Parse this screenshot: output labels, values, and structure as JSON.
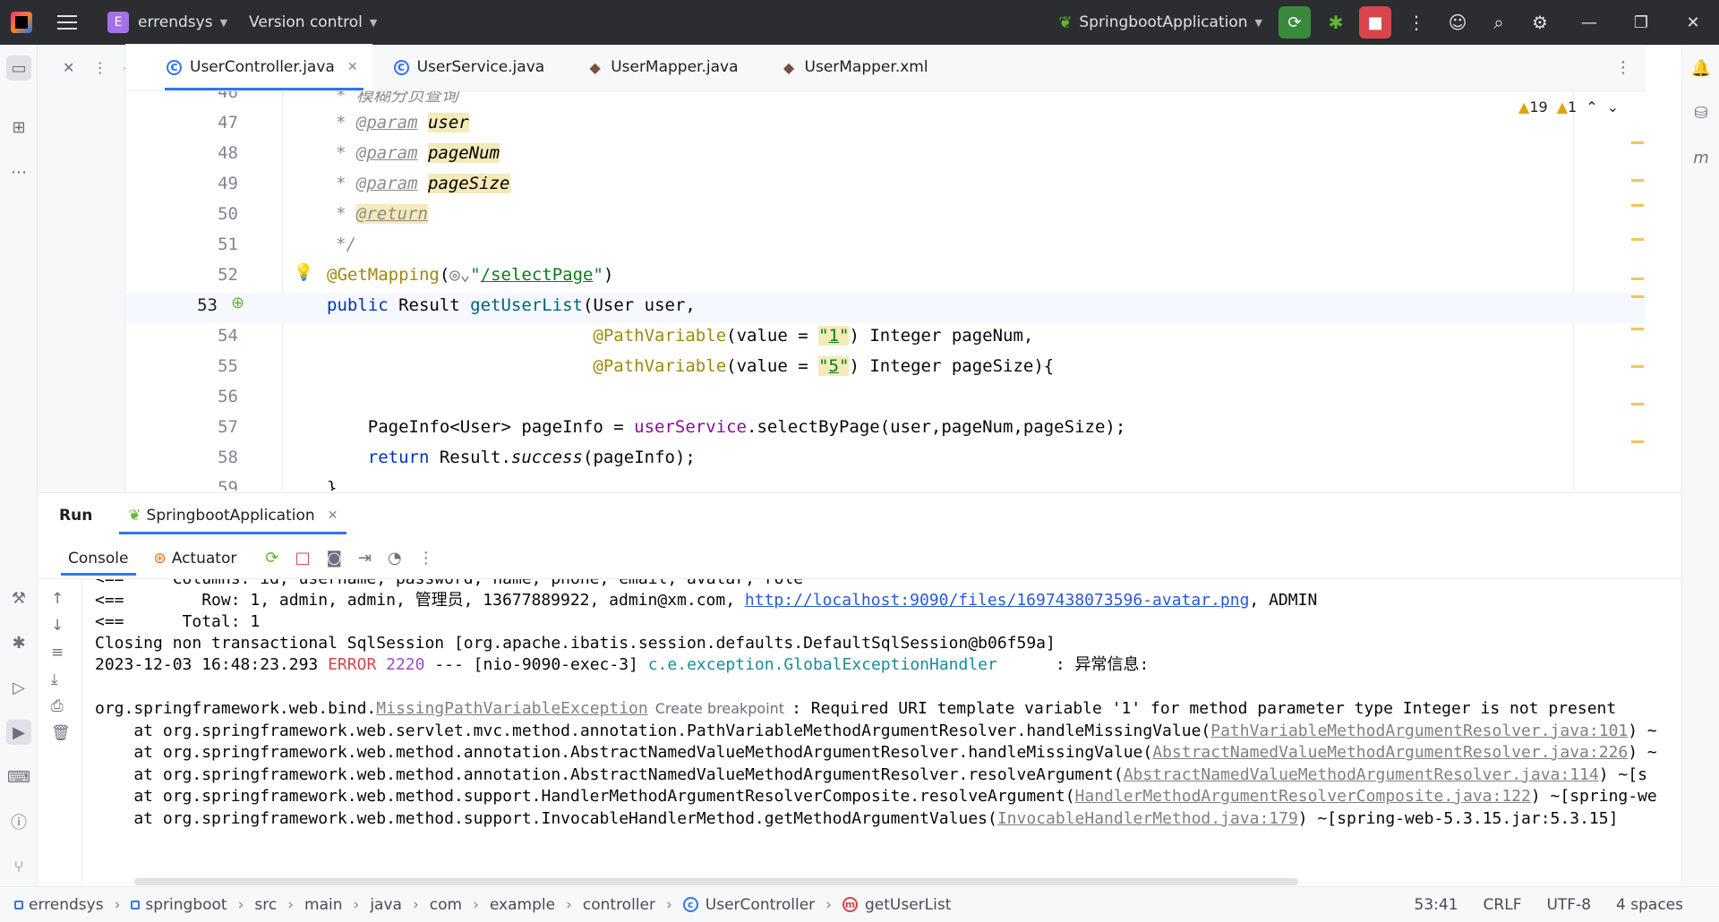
{
  "titlebar": {
    "project_badge": "E",
    "project_name": "errendsys",
    "version_control": "Version control",
    "run_config": "SpringbootApplication",
    "accent_color": "#3574f0"
  },
  "tabs": [
    {
      "label": "UserController.java",
      "icon": "class-icon",
      "active": true
    },
    {
      "label": "UserService.java",
      "icon": "class-icon",
      "active": false
    },
    {
      "label": "UserMapper.java",
      "icon": "mybatis-icon",
      "active": false
    },
    {
      "label": "UserMapper.xml",
      "icon": "mybatis-icon",
      "active": false
    }
  ],
  "editor": {
    "warnings_count": "19",
    "weak_warnings_count": "1",
    "lines": [
      {
        "num": "46",
        "text": "* 模糊分页查询"
      },
      {
        "num": "47",
        "text": "* @param user"
      },
      {
        "num": "48",
        "text": "* @param pageNum"
      },
      {
        "num": "49",
        "text": "* @param pageSize"
      },
      {
        "num": "50",
        "text": "* @return"
      },
      {
        "num": "51",
        "text": "*/"
      },
      {
        "num": "52",
        "text": "@GetMapping(\"/selectPage\")"
      },
      {
        "num": "53",
        "text": "public Result getUserList(User user,"
      },
      {
        "num": "54",
        "text": "@PathVariable(value = \"1\") Integer pageNum,"
      },
      {
        "num": "55",
        "text": "@PathVariable(value = \"5\") Integer pageSize){"
      },
      {
        "num": "56",
        "text": ""
      },
      {
        "num": "57",
        "text": "PageInfo<User> pageInfo = userService.selectByPage(user,pageNum,pageSize);"
      },
      {
        "num": "58",
        "text": "return Result.success(pageInfo);"
      },
      {
        "num": "59",
        "text": "}"
      }
    ]
  },
  "run": {
    "panel_title": "Run",
    "tab_label": "SpringbootApplication",
    "console_tab": "Console",
    "actuator_tab": "Actuator"
  },
  "console": {
    "line0": "<==     Columns: id, username, password, name, phone, email, avatar, role",
    "line1_prefix": "<==        Row: 1, admin, admin, 管理员, 13677889922, admin@xm.com, ",
    "line1_link": "http://localhost:9090/files/1697438073596-avatar.png",
    "line1_suffix": ", ADMIN",
    "line2": "<==      Total: 1",
    "line3": "Closing non transactional SqlSession [org.apache.ibatis.session.defaults.DefaultSqlSession@b06f59a]",
    "line4_time": "2023-12-03 16:48:23.293 ",
    "line4_level": "ERROR",
    "line4_pid": " 2220",
    "line4_mid": " --- [nio-9090-exec-3] ",
    "line4_class": "c.e.exception.GlobalExceptionHandler",
    "line4_msg": "      : 异常信息:",
    "line5_prefix": "org.springframework.web.bind.",
    "line5_exc": "MissingPathVariableException",
    "line5_bp": "Create breakpoint",
    "line5_msg": ": Required URI template variable '1' for method parameter type Integer is not present",
    "line6_prefix": "    at org.springframework.web.servlet.mvc.method.annotation.PathVariableMethodArgumentResolver.handleMissingValue(",
    "line6_link": "PathVariableMethodArgumentResolver.java:101",
    "line6_suffix": ") ~",
    "line7_prefix": "    at org.springframework.web.method.annotation.AbstractNamedValueMethodArgumentResolver.handleMissingValue(",
    "line7_link": "AbstractNamedValueMethodArgumentResolver.java:226",
    "line7_suffix": ") ~",
    "line8_prefix": "    at org.springframework.web.method.annotation.AbstractNamedValueMethodArgumentResolver.resolveArgument(",
    "line8_link": "AbstractNamedValueMethodArgumentResolver.java:114",
    "line8_suffix": ") ~[s",
    "line9_prefix": "    at org.springframework.web.method.support.HandlerMethodArgumentResolverComposite.resolveArgument(",
    "line9_link": "HandlerMethodArgumentResolverComposite.java:122",
    "line9_suffix": ") ~[spring-we",
    "line10_prefix": "    at org.springframework.web.method.support.InvocableHandlerMethod.getMethodArgumentValues(",
    "line10_link": "InvocableHandlerMethod.java:179",
    "line10_suffix": ") ~[spring-web-5.3.15.jar:5.3.15]"
  },
  "statusbar": {
    "breadcrumbs": [
      "errendsys",
      "springboot",
      "src",
      "main",
      "java",
      "com",
      "example",
      "controller",
      "UserController",
      "getUserList"
    ],
    "position": "53:41",
    "line_sep": "CRLF",
    "encoding": "UTF-8",
    "indent": "4 spaces"
  }
}
